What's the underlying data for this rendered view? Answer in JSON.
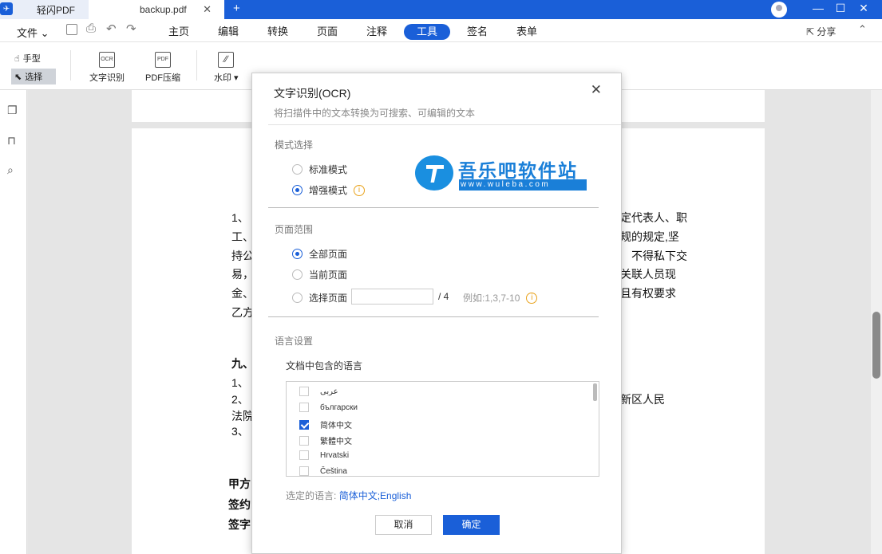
{
  "titlebar": {
    "app_name": "轻闪PDF",
    "doc_tab": "backup.pdf",
    "add_tab": "+",
    "minimize": "—",
    "maximize": "☐",
    "close": "✕"
  },
  "menubar": {
    "file": "文件 ⌄",
    "tabs": [
      "主页",
      "编辑",
      "转换",
      "页面",
      "注释",
      "工具",
      "签名",
      "表单"
    ],
    "active_tab": "工具",
    "share": "分享",
    "collapse": "⌃"
  },
  "toolbar": {
    "hand": "手型",
    "select": "选择",
    "ocr": "文字识别",
    "ocr_icon_text": "OCR",
    "compress": "PDF压缩",
    "compress_icon_text": "PDF",
    "watermark": "水印 ▾"
  },
  "document": {
    "lines": [
      {
        "left": "1、",
        "right": "定代表人、职"
      },
      {
        "left": "工、",
        "right": "规的规定,坚"
      },
      {
        "left": "持公",
        "right": "不得私下交"
      },
      {
        "left": "易，",
        "right": "关联人员现"
      },
      {
        "left": "金、",
        "right": "且有权要求"
      },
      {
        "left": "乙方",
        "right": ""
      }
    ],
    "section9": "九、",
    "lines2": [
      {
        "left": "1、",
        "right": ""
      },
      {
        "left": "2、",
        "right": "新区人民"
      },
      {
        "left": "法院",
        "right": ""
      },
      {
        "left": "3、",
        "right": ""
      }
    ],
    "sig_lines": [
      "甲方",
      "签约",
      "签字"
    ]
  },
  "modal": {
    "title": "文字识别(OCR)",
    "subtitle": "将扫描件中的文本转换为可搜索、可编辑的文本",
    "close": "✕",
    "mode_label": "模式选择",
    "mode_standard": "标准模式",
    "mode_enhanced": "增强模式",
    "range_label": "页面范围",
    "range_all": "全部页面",
    "range_current": "当前页面",
    "range_select": "选择页面",
    "page_input_value": "",
    "page_total": "/ 4",
    "page_example": "例如:1,3,7-10",
    "info_glyph": "i",
    "lang_section": "语言设置",
    "lang_heading": "文档中包含的语言",
    "languages": [
      {
        "name": "عربى",
        "checked": false
      },
      {
        "name": "български",
        "checked": false
      },
      {
        "name": "简体中文",
        "checked": true
      },
      {
        "name": "繁體中文",
        "checked": false
      },
      {
        "name": "Hrvatski",
        "checked": false
      },
      {
        "name": "Čeština",
        "checked": false
      }
    ],
    "selected_label": "选定的语言:",
    "selected_value": "简体中文;English",
    "cancel": "取消",
    "ok": "确定"
  },
  "watermark": {
    "main": "吾乐吧软件站",
    "sub": "www.wuleba.com"
  }
}
